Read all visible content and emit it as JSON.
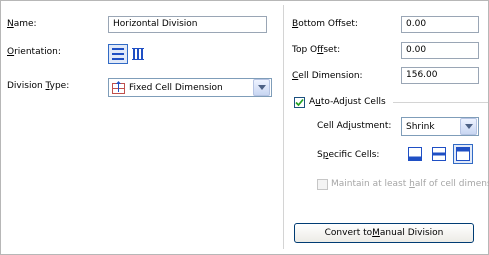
{
  "left": {
    "name_label": "Name:",
    "name_value": "Horizontal Division",
    "orientation_label": "Orientation:",
    "orientation_icons": [
      "horizontal-lines-icon",
      "vertical-lines-icon"
    ],
    "division_type_label": "Division Type:",
    "division_type_value": "Fixed Cell Dimension",
    "division_type_icon": "fixed-cell-dimension-icon"
  },
  "right": {
    "bottom_offset_label": "Bottom Offset:",
    "bottom_offset_value": "0.00",
    "top_offset_label": "Top Offset:",
    "top_offset_value": "0.00",
    "cell_dimension_label": "Cell Dimension:",
    "cell_dimension_value": "156.00",
    "auto_adjust_label": "Auto-Adjust Cells",
    "auto_adjust_checked": true,
    "cell_adjustment_label": "Cell Adjustment:",
    "cell_adjustment_value": "Shrink",
    "specific_cells_label": "Specific Cells:",
    "specific_cells_icons": [
      "cell-bottom-icon",
      "cell-middle-icon",
      "cell-top-icon"
    ],
    "maintain_label": "Maintain at least half of cell dimensio",
    "convert_button": "Convert to Manual Division"
  },
  "colors": {
    "accent": "#316ac5",
    "icon_blue": "#1f4fc4",
    "border": "#7f9db9",
    "disabled_text": "#a6a6a6"
  }
}
